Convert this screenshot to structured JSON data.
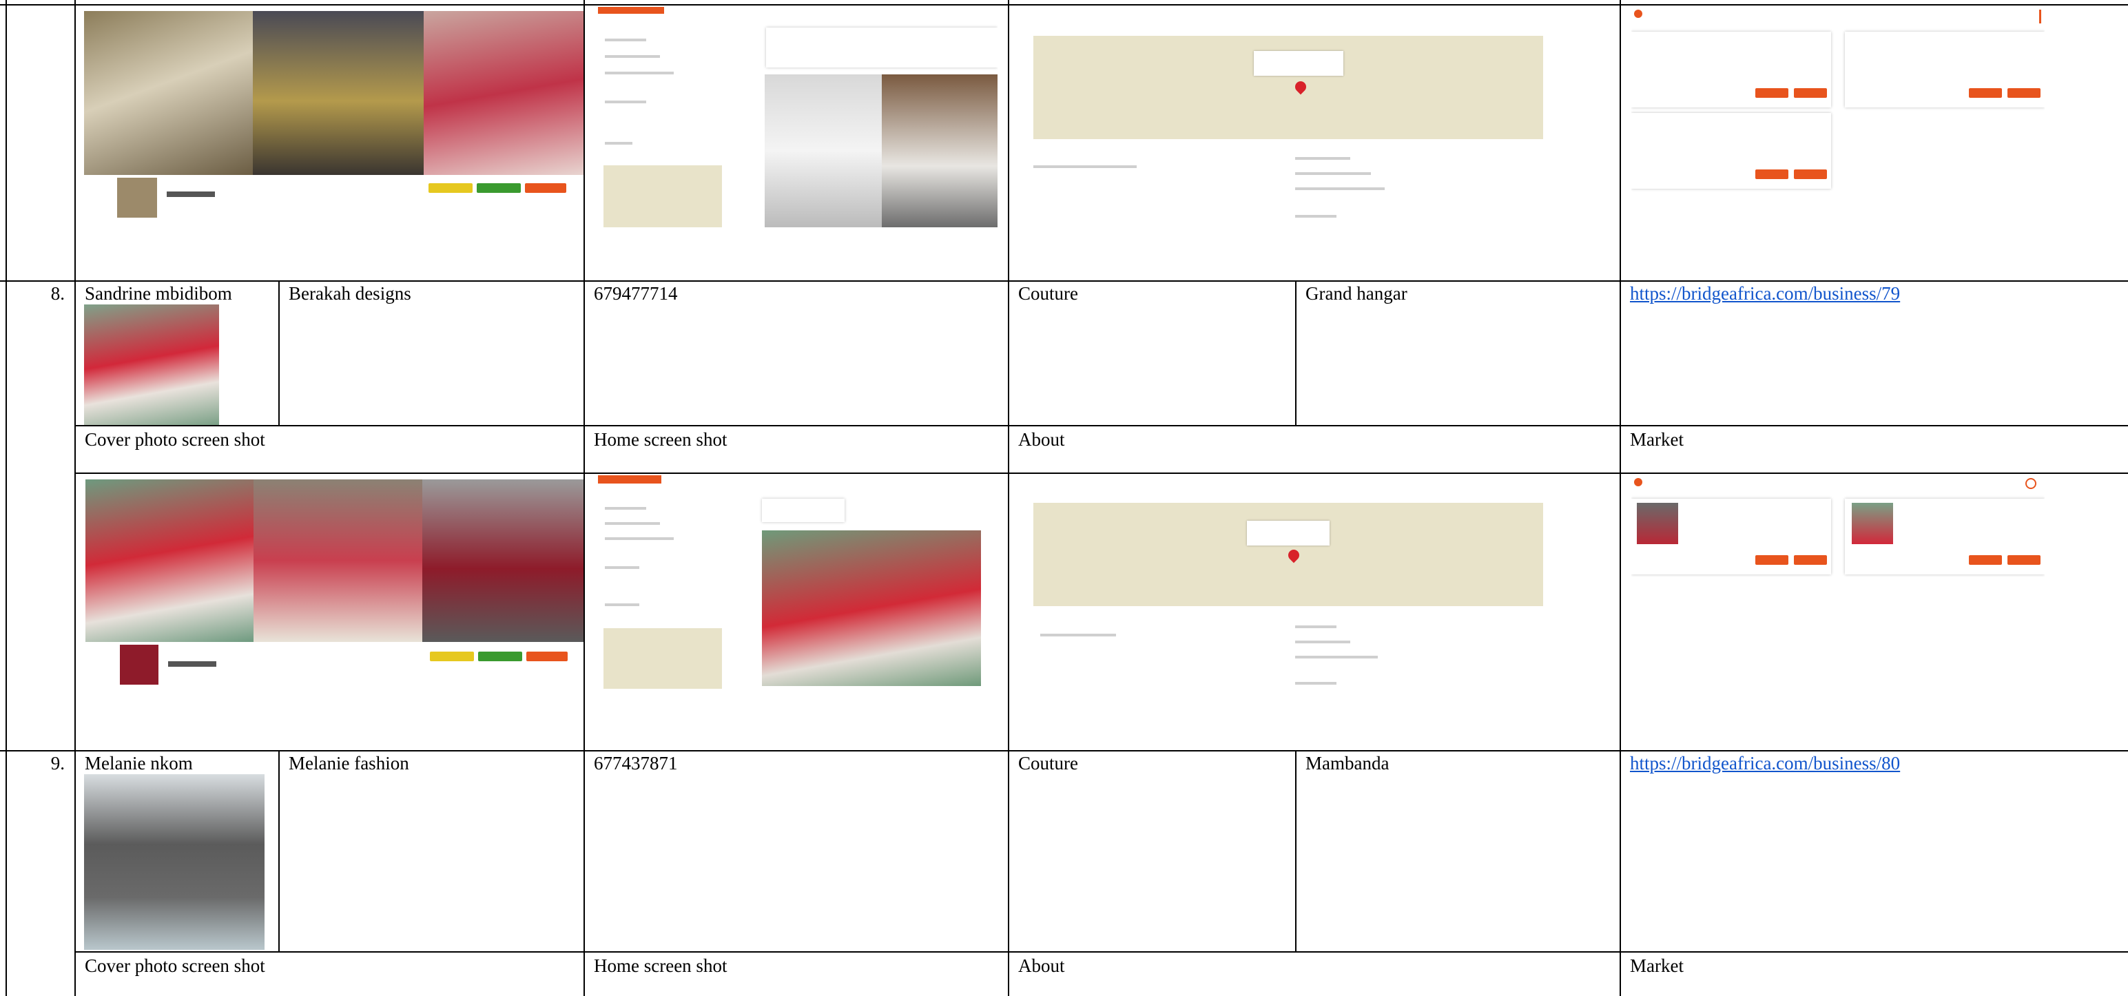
{
  "rows": [
    {
      "number": "8.",
      "owner_name": "Sandrine mbidibom",
      "business_name": "Berakah designs",
      "phone": "679477714",
      "category": "Couture",
      "location": "Grand hangar",
      "link": "https://bridgeafrica.com/business/79"
    },
    {
      "number": "9.",
      "owner_name": "Melanie nkom",
      "business_name": "Melanie fashion",
      "phone": "677437871",
      "category": "Couture",
      "location": "Mambanda",
      "link": "https://bridgeafrica.com/business/80"
    }
  ],
  "screenshot_labels": {
    "cover": "Cover photo screen shot",
    "home": "Home screen shot",
    "about": "About",
    "market": "Market"
  },
  "colors": {
    "accent": "#e8541d",
    "green": "#3a9a2f",
    "yellow": "#e6c820",
    "link": "#1155cc"
  }
}
